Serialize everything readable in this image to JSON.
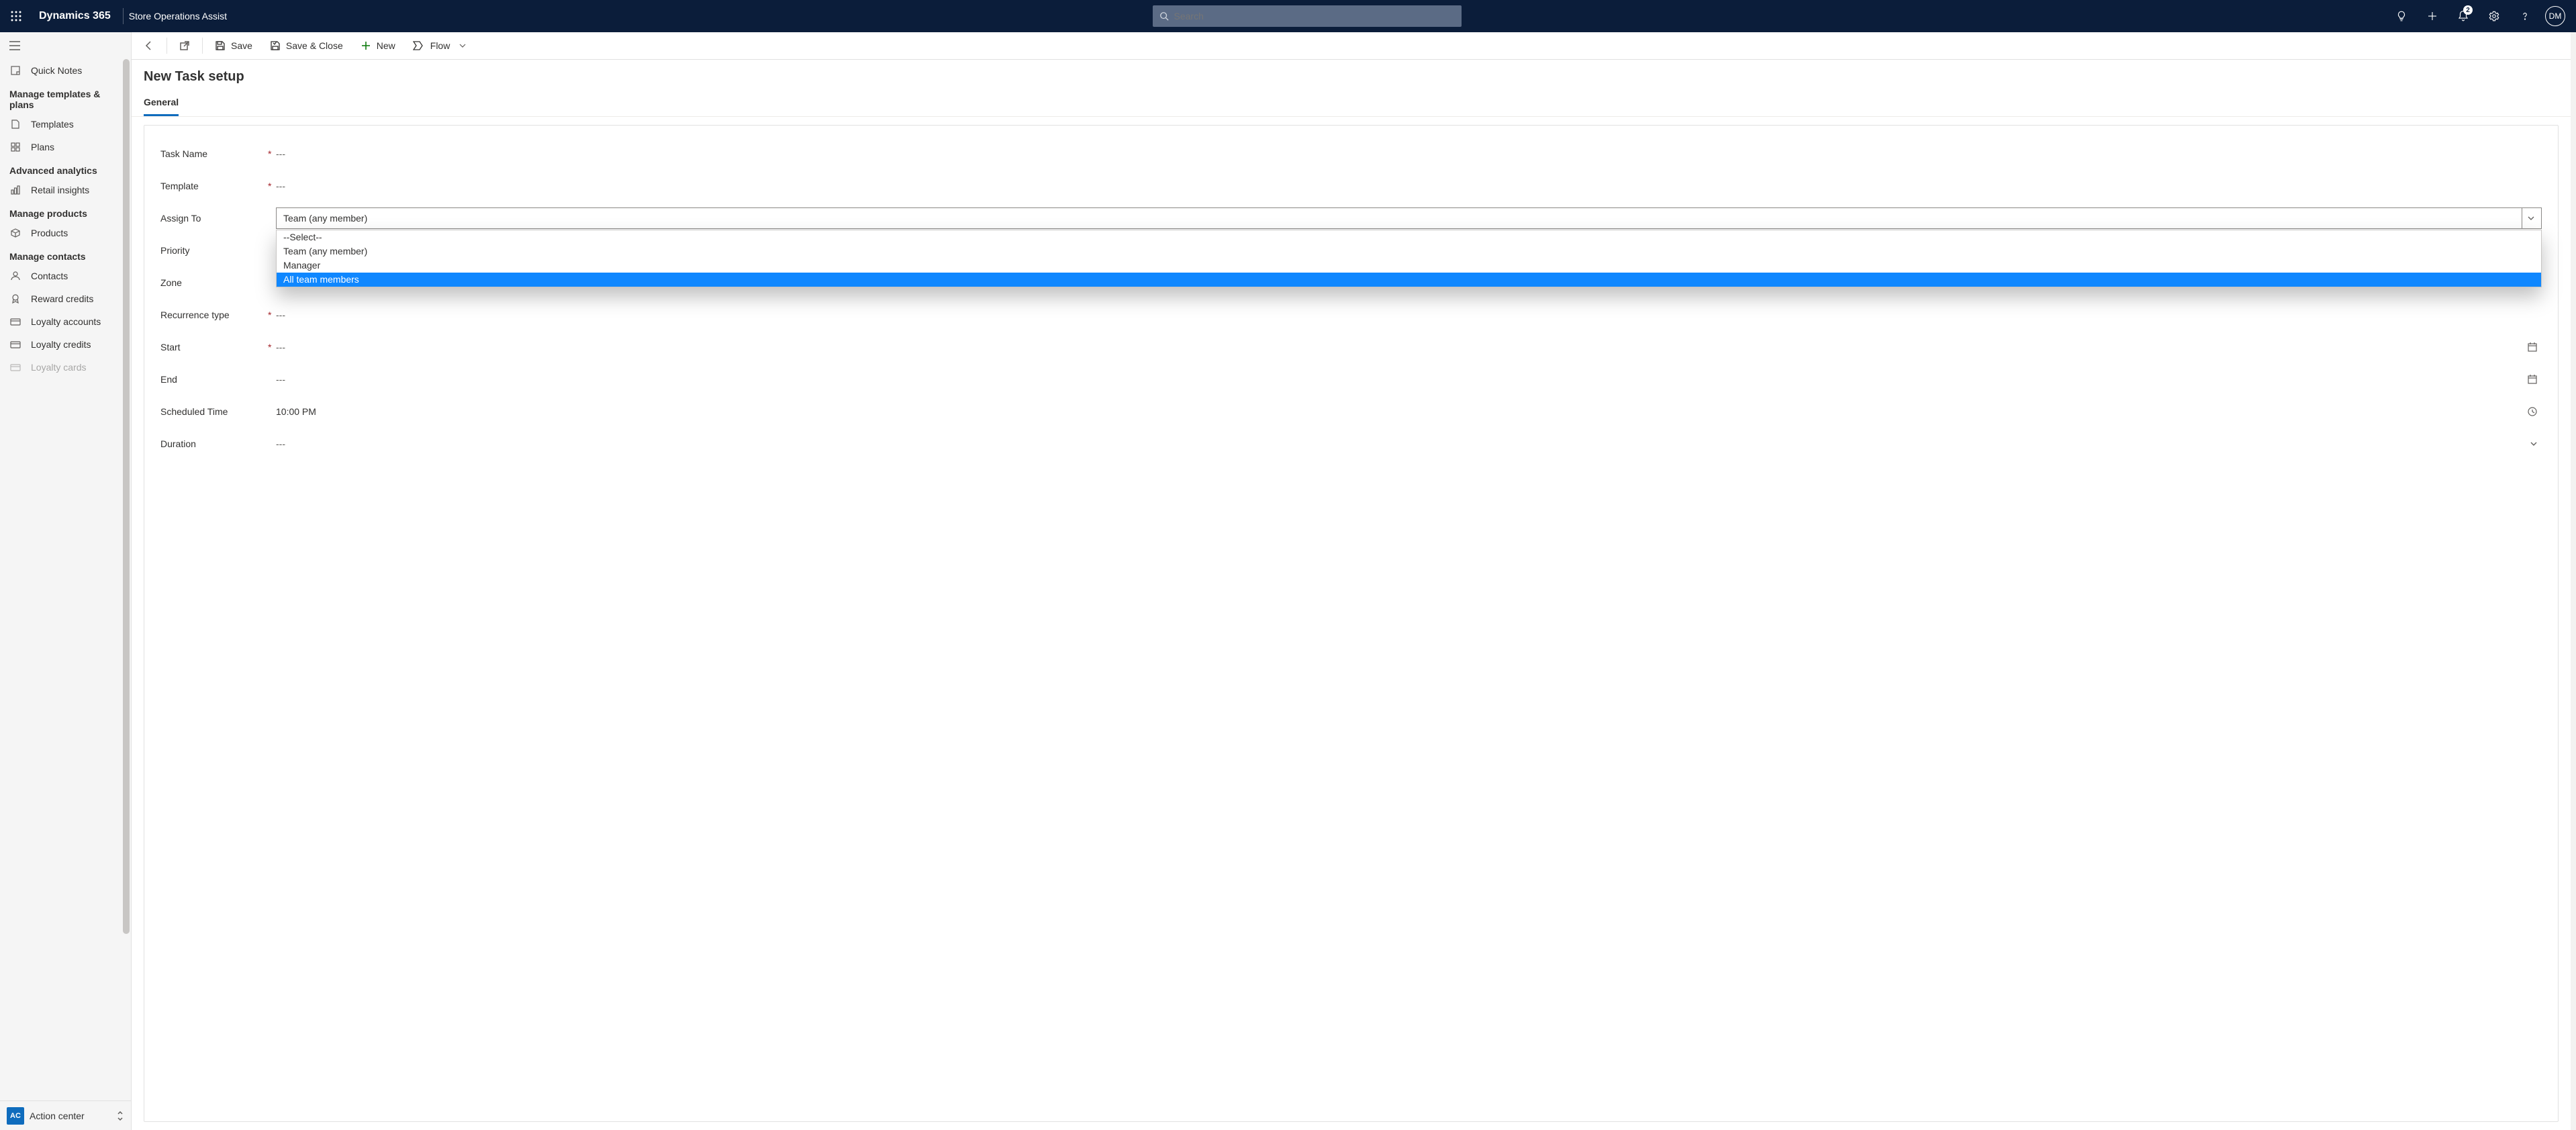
{
  "topbar": {
    "brand": "Dynamics 365",
    "app_name": "Store Operations Assist",
    "search_placeholder": "Search",
    "notification_count": "2",
    "avatar_initials": "DM"
  },
  "sidebar": {
    "items": [
      {
        "type": "item",
        "icon": "note",
        "label": "Quick Notes"
      },
      {
        "type": "group",
        "label": "Manage templates & plans"
      },
      {
        "type": "item",
        "icon": "template",
        "label": "Templates"
      },
      {
        "type": "item",
        "icon": "grid",
        "label": "Plans"
      },
      {
        "type": "group",
        "label": "Advanced analytics"
      },
      {
        "type": "item",
        "icon": "insights",
        "label": "Retail insights"
      },
      {
        "type": "group",
        "label": "Manage products"
      },
      {
        "type": "item",
        "icon": "box",
        "label": "Products"
      },
      {
        "type": "group",
        "label": "Manage contacts"
      },
      {
        "type": "item",
        "icon": "person",
        "label": "Contacts"
      },
      {
        "type": "item",
        "icon": "award",
        "label": "Reward credits"
      },
      {
        "type": "item",
        "icon": "card",
        "label": "Loyalty accounts"
      },
      {
        "type": "item",
        "icon": "card",
        "label": "Loyalty credits"
      },
      {
        "type": "item",
        "icon": "card",
        "label": "Loyalty cards",
        "faded": true
      }
    ],
    "footer": {
      "badge": "AC",
      "label": "Action center"
    }
  },
  "commands": {
    "back": "",
    "share": "",
    "save": "Save",
    "save_close": "Save & Close",
    "new": "New",
    "flow": "Flow"
  },
  "page": {
    "title": "New Task setup",
    "tab_general": "General"
  },
  "form": {
    "task_name": {
      "label": "Task Name",
      "value": "---",
      "required": true
    },
    "template": {
      "label": "Template",
      "value": "---",
      "required": true
    },
    "assign_to": {
      "label": "Assign To",
      "selected": "Team (any member)",
      "options": [
        "--Select--",
        "Team (any member)",
        "Manager",
        "All team members"
      ],
      "highlighted": "All team members"
    },
    "priority": {
      "label": "Priority",
      "value": ""
    },
    "zone": {
      "label": "Zone",
      "value": "---"
    },
    "recurrence": {
      "label": "Recurrence type",
      "value": "---",
      "required": true
    },
    "start": {
      "label": "Start",
      "value": "---",
      "required": true
    },
    "end": {
      "label": "End",
      "value": "---"
    },
    "scheduled_time": {
      "label": "Scheduled Time",
      "value": "10:00 PM"
    },
    "duration": {
      "label": "Duration",
      "value": "---"
    }
  }
}
